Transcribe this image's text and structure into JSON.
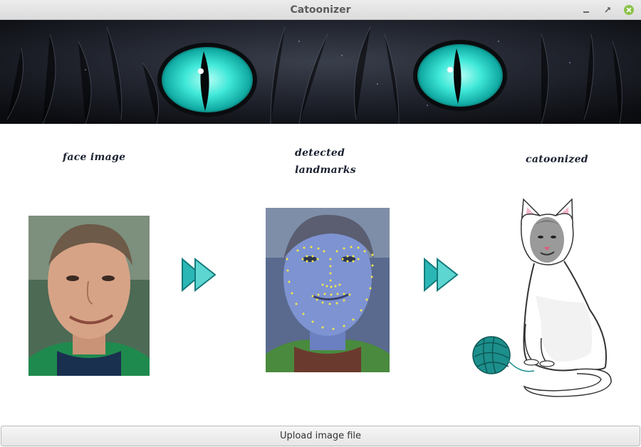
{
  "window": {
    "title": "Catoonizer",
    "controls": [
      "minimize-icon",
      "restore-icon",
      "close-icon"
    ],
    "close_color": "#8bc34a"
  },
  "banner": {
    "subject": "cat-eyes-banner",
    "eye_color": "#2fe0d2"
  },
  "panels": {
    "face_label": "face image",
    "detected_label": "detected landmarks",
    "catoonized_label": "catoonized"
  },
  "arrows": [
    "fast-forward-icon",
    "fast-forward-icon"
  ],
  "arrow_color": "#2bb6b6",
  "landmark_color": "#f2e84a",
  "upload_button": {
    "label": "Upload image file"
  }
}
